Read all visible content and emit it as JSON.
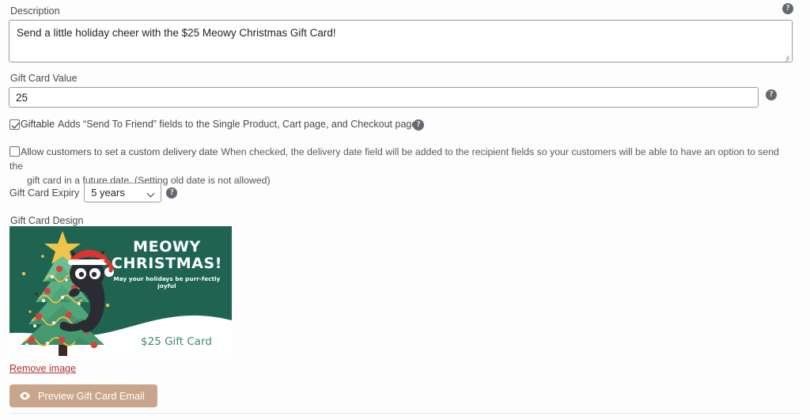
{
  "description": {
    "label": "Description",
    "value": "Send a little holiday cheer with the $25 Meowy Christmas Gift Card!",
    "help_icon": "?"
  },
  "gift_card_value": {
    "label": "Gift Card Value",
    "value": "25",
    "help_icon": "?"
  },
  "giftable": {
    "checked_label": "Giftable",
    "description": "Adds “Send To Friend” fields to the Single Product, Cart page, and Checkout page.",
    "checked": true,
    "help_icon": "?"
  },
  "delivery_date": {
    "label": "Allow customers to set a custom delivery date",
    "description_line1": "When checked, the delivery date field will be added to the recipient fields so your customers will be able to have an option to send the",
    "description_line2": "gift card in a future date. (Setting old date is not allowed)",
    "checked": false
  },
  "expiry": {
    "label": "Gift Card Expiry",
    "selected": "5 years",
    "options": [
      "5 years"
    ],
    "help_icon": "?"
  },
  "design": {
    "label": "Gift Card Design",
    "card": {
      "title_line1": "MEOWY",
      "title_line2": "CHRISTMAS!",
      "subtitle": "May your holidays be purr-fectly joyful",
      "amount": "$25 Gift Card",
      "background_color": "#1f6450",
      "snow_color": "#ffffff",
      "amount_color": "#3f8a6e",
      "star_color": "#f0c44a",
      "tree_color": "#4fa07a",
      "bauble_color": "#d8413a",
      "garland_color": "#e8b94a",
      "cat_color": "#2b2b33",
      "hat_color": "#e0322f"
    },
    "remove_link": "Remove image"
  },
  "preview_button": {
    "label": "Preview Gift Card Email",
    "icon": "eye-icon",
    "color": "#c9a68b"
  }
}
